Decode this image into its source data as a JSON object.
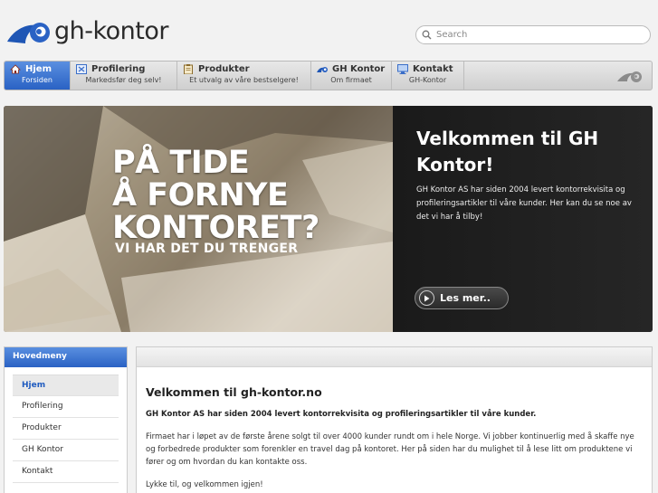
{
  "brand": {
    "name": "gh-kontor",
    "accent": "#2a62c4"
  },
  "search": {
    "placeholder": "Search"
  },
  "nav": {
    "items": [
      {
        "title": "Hjem",
        "sub": "Forsiden",
        "icon": "home-icon"
      },
      {
        "title": "Profilering",
        "sub": "Markedsfør deg selv!",
        "icon": "profile-icon"
      },
      {
        "title": "Produkter",
        "sub": "Et utvalg av våre bestselgere!",
        "icon": "clipboard-icon"
      },
      {
        "title": "GH Kontor",
        "sub": "Om firmaet",
        "icon": "logo-icon"
      },
      {
        "title": "Kontakt",
        "sub": "GH-Kontor",
        "icon": "monitor-icon"
      }
    ]
  },
  "hero": {
    "headline_1": "PÅ TIDE",
    "headline_2": "Å FORNYE",
    "headline_3": "KONTORET?",
    "tagline": "VI HAR DET DU TRENGER",
    "title": "Velkommen til GH Kontor!",
    "text": "GH Kontor AS har siden 2004 levert kontorrekvisita og profileringsartikler til våre kunder. Her kan du se noe av det vi har å tilby!",
    "button": "Les mer.."
  },
  "sidebar": {
    "heading": "Hovedmeny",
    "items": [
      "Hjem",
      "Profilering",
      "Produkter",
      "GH Kontor",
      "Kontakt"
    ]
  },
  "main": {
    "title": "Velkommen til gh-kontor.no",
    "lead": "GH Kontor AS har siden 2004 levert kontorrekvisita og profileringsartikler til våre kunder.",
    "body": "Firmaet har i løpet av de første årene solgt til over 4000 kunder rundt om i hele Norge. Vi jobber kontinuerlig med å skaffe nye og forbedrede produkter som forenkler en travel dag på kontoret. Her på siden har du mulighet til å lese litt om produktene vi fører og om hvordan du kan kontakte oss.",
    "sign": "Lykke til, og velkommen igjen!"
  }
}
